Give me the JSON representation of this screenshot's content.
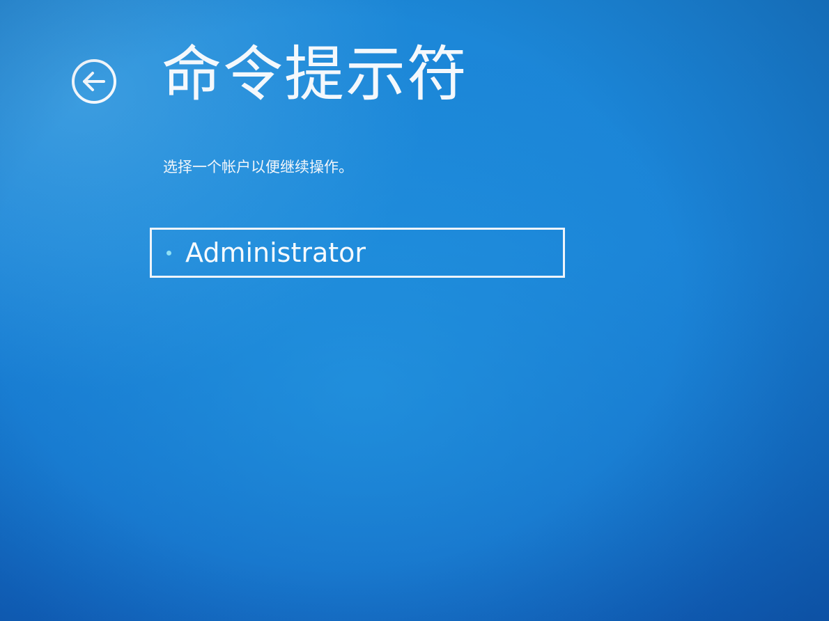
{
  "header": {
    "title": "命令提示符",
    "back_icon": "back-arrow-circle-icon"
  },
  "instruction": "选择一个帐户以便继续操作。",
  "accounts": [
    {
      "label": "Administrator",
      "bullet_icon": "bullet-dot-icon"
    }
  ],
  "colors": {
    "background": "#1a7fd6",
    "foreground": "#ffffff",
    "bullet": "#8fe0f5"
  }
}
